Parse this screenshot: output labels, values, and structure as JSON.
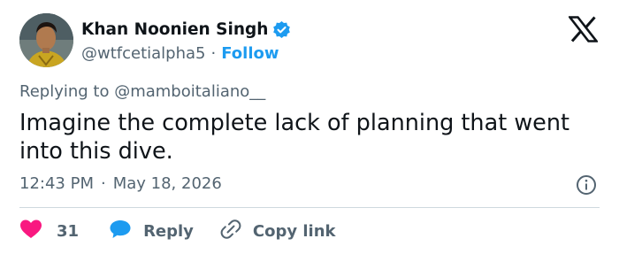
{
  "author": {
    "name": "Khan Noonien Singh",
    "handle": "@wtfcetialpha5",
    "separator": "·",
    "follow_label": "Follow"
  },
  "reply_context": {
    "text": "Replying to @mamboitaliano__"
  },
  "tweet": {
    "text": "Imagine the complete lack of planning that went into this dive."
  },
  "meta": {
    "time": "12:43 PM",
    "separator": "·",
    "date": "May 18, 2026"
  },
  "actions": {
    "like_count": "31",
    "reply_label": "Reply",
    "copy_label": "Copy link"
  },
  "icons": {
    "verified": "verified-badge-icon",
    "logo": "x-logo-icon",
    "info": "info-icon",
    "like": "heart-icon",
    "reply": "speech-bubble-icon",
    "copy": "link-icon"
  },
  "colors": {
    "accent": "#1d9bf0",
    "like": "#f91880",
    "text": "#0f1419",
    "secondary": "#536471"
  }
}
